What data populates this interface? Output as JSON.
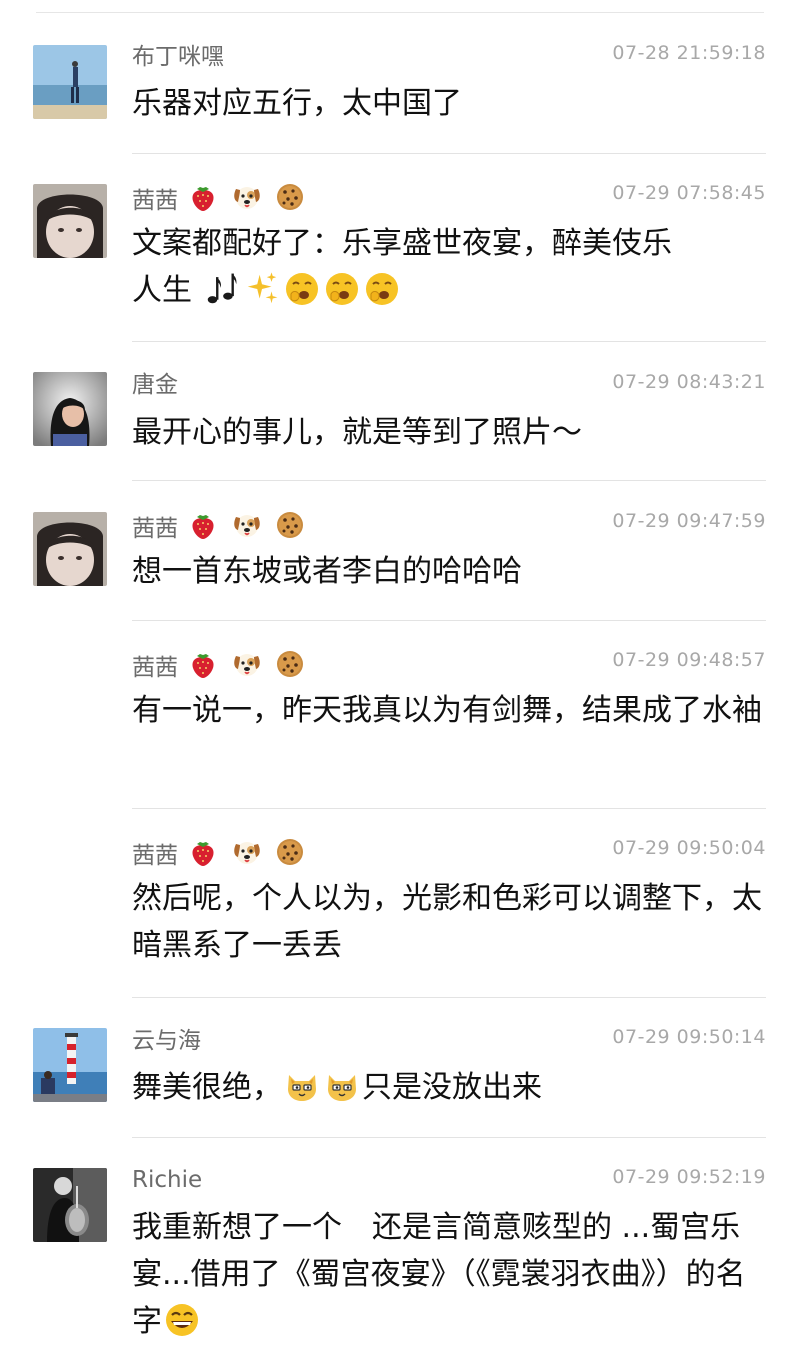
{
  "comments": [
    {
      "name": "布丁咪嘿",
      "time": "07-28 21:59:18",
      "text": "乐器对应五行，太中国了"
    },
    {
      "name": "茜茜",
      "time": "07-29 07:58:45",
      "text_a": "文案都配好了：乐享盛世夜宴，醉美伎乐",
      "text_b": "人生"
    },
    {
      "name": "唐金",
      "time": "07-29 08:43:21",
      "text": "最开心的事儿，就是等到了照片～"
    },
    {
      "name": "茜茜",
      "time": "07-29 09:47:59",
      "text": "想一首东坡或者李白的哈哈哈"
    },
    {
      "name": "茜茜",
      "time": "07-29 09:48:57",
      "text": "有一说一，昨天我真以为有剑舞，结果成了水袖"
    },
    {
      "name": "茜茜",
      "time": "07-29 09:50:04",
      "text": "然后呢，个人以为，光影和色彩可以调整下，太暗黑系了一丢丢"
    },
    {
      "name": "云与海",
      "time": "07-29 09:50:14",
      "text_a": "舞美很绝，",
      "text_b": "只是没放出来"
    },
    {
      "name": "Richie",
      "time": "07-29 09:52:19",
      "text": "我重新想了一个　还是言简意赅型的 ...蜀宫乐宴...借用了《蜀宫夜宴》（《霓裳羽衣曲》）的名字"
    }
  ],
  "name_emojis": [
    "strawberry-icon",
    "dog-face-icon",
    "cookie-icon"
  ],
  "colors": {
    "name": "#6b6b6b",
    "time": "#a8a8a8",
    "text": "#111111",
    "separator": "#e3e3e3"
  }
}
